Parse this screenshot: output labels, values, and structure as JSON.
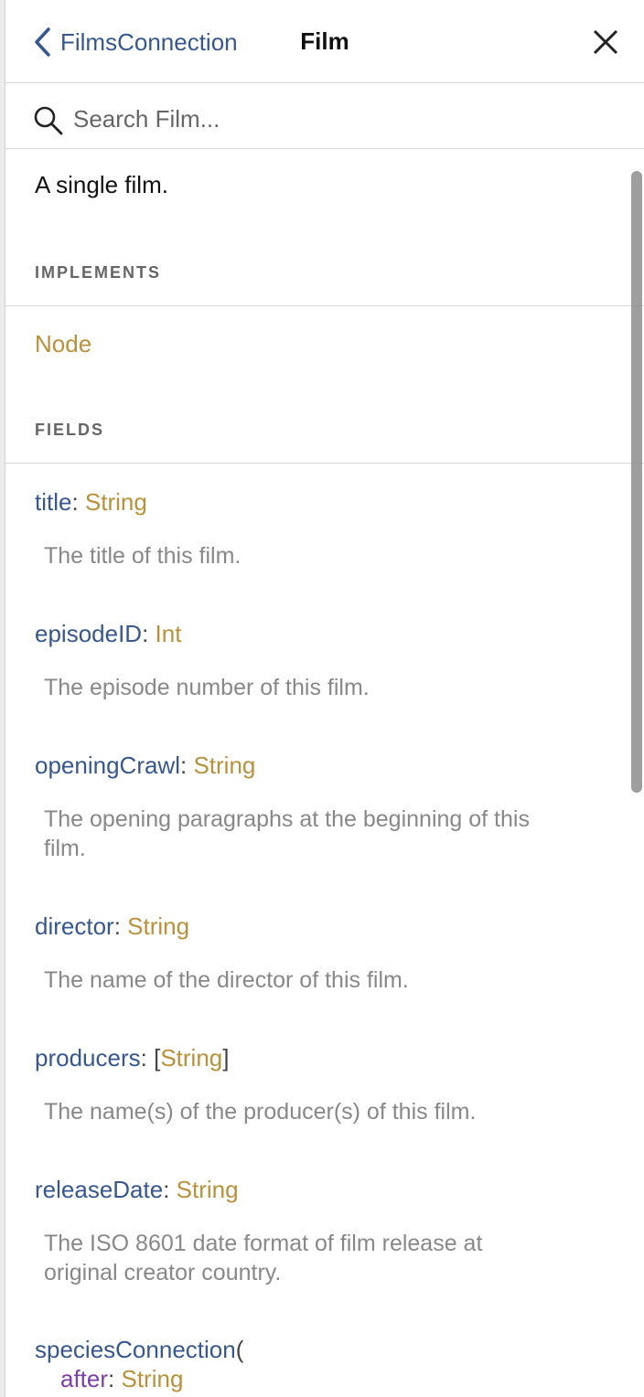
{
  "header": {
    "back_label": "FilmsConnection",
    "title": "Film"
  },
  "search": {
    "placeholder": "Search Film..."
  },
  "description": "A single film.",
  "implements": {
    "heading": "IMPLEMENTS",
    "items": [
      "Node"
    ]
  },
  "fields_section": {
    "heading": "FIELDS"
  },
  "fields": [
    {
      "name": "title",
      "type": "String",
      "description": "The title of this film."
    },
    {
      "name": "episodeID",
      "type": "Int",
      "description": "The episode number of this film."
    },
    {
      "name": "openingCrawl",
      "type": "String",
      "description_line1": "The opening paragraphs at the beginning of this",
      "description_line2": "film."
    },
    {
      "name": "director",
      "type": "String",
      "description": "The name of the director of this film."
    },
    {
      "name": "producers",
      "type": "String",
      "open_bracket": "[",
      "close_bracket": "]",
      "description": "The name(s) of the producer(s) of this film."
    },
    {
      "name": "releaseDate",
      "type": "String",
      "description_line1": "The ISO 8601 date format of film release at",
      "description_line2": "original creator country."
    },
    {
      "name": "speciesConnection",
      "open_paren": "(",
      "arg_name": "after",
      "arg_type": "String"
    }
  ],
  "colors": {
    "field_name": "#37578f",
    "type": "#b8913a",
    "arg": "#7b3fa6",
    "description": "#888888"
  }
}
